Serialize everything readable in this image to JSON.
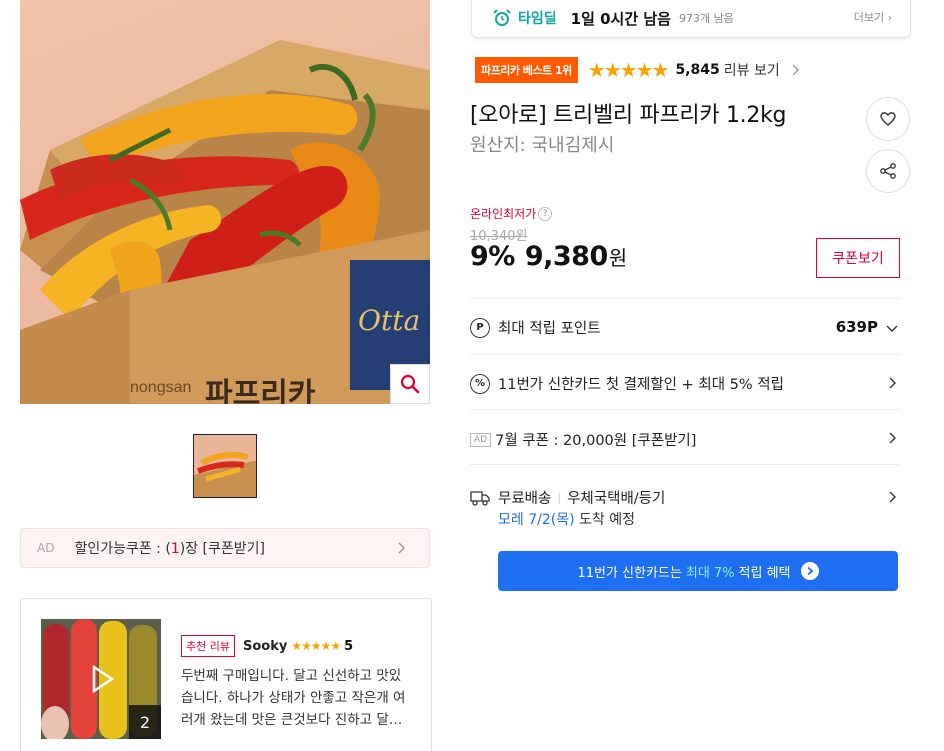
{
  "product": {
    "main_image_alt": "트리벨리 파프리카 상자",
    "box_brand": "nongsan",
    "box_label": "파프리카",
    "box_logo": "Otta"
  },
  "timedeal": {
    "label": "타임딜",
    "remaining": "1일 0시간 남음",
    "count": "973개 남음",
    "more": "더보기"
  },
  "rating": {
    "badge": "파프리카 베스트 1위",
    "stars": "★★★★★",
    "review_count": "5,845",
    "review_link": "리뷰 보기"
  },
  "title": "[오아로] 트리벨리 파프리카 1.2kg",
  "origin": "원산지:  국내김제시",
  "price": {
    "lowest_label": "온라인최저가",
    "qmark": "?",
    "original": "10,340원",
    "discount": "9%",
    "final": "9,380",
    "won": "원",
    "coupon_button": "쿠폰보기"
  },
  "rows": {
    "points_label": "최대 적립 포인트",
    "points_value": "639P",
    "points_icon": "P",
    "card_discount": "11번가 신한카드 첫 결제할인 + 최대 5% 적립",
    "card_icon": "%",
    "ad_label": "AD",
    "coupon_text": "7월 쿠폰 : 20,000원 [쿠폰받기]",
    "shipping_free": "무료배송",
    "shipping_method": "우체국택배/등기",
    "arrival_date": "모레 7/2(목)",
    "arrival_suffix": "도착 예정"
  },
  "card_benefit": {
    "prefix": "11번가 신한카드는",
    "highlight": "최대 7%",
    "suffix": "적립 혜택"
  },
  "ad_coupon": {
    "ad": "AD",
    "prefix": "할인가능쿠폰 : (",
    "count": "1",
    "suffix": ")장 [쿠폰받기]"
  },
  "review": {
    "badge": "추천 리뷰",
    "reviewer": "Sooky",
    "stars": "★★★★★",
    "score": "5",
    "image_count": "2",
    "text": "두번째 구매입니다. 달고 신선하고 맛있습니다. 하나가 상태가 안좋고 작은개 여러개 왔는데 맛은 큰것보다 진하고 달…"
  },
  "colors": {
    "accent_red": "#e4002b",
    "timedeal_teal": "#11a6a3",
    "badge_orange": "#ff5a00",
    "star": "#f7a400",
    "benefit_blue": "#1e6ff2"
  }
}
